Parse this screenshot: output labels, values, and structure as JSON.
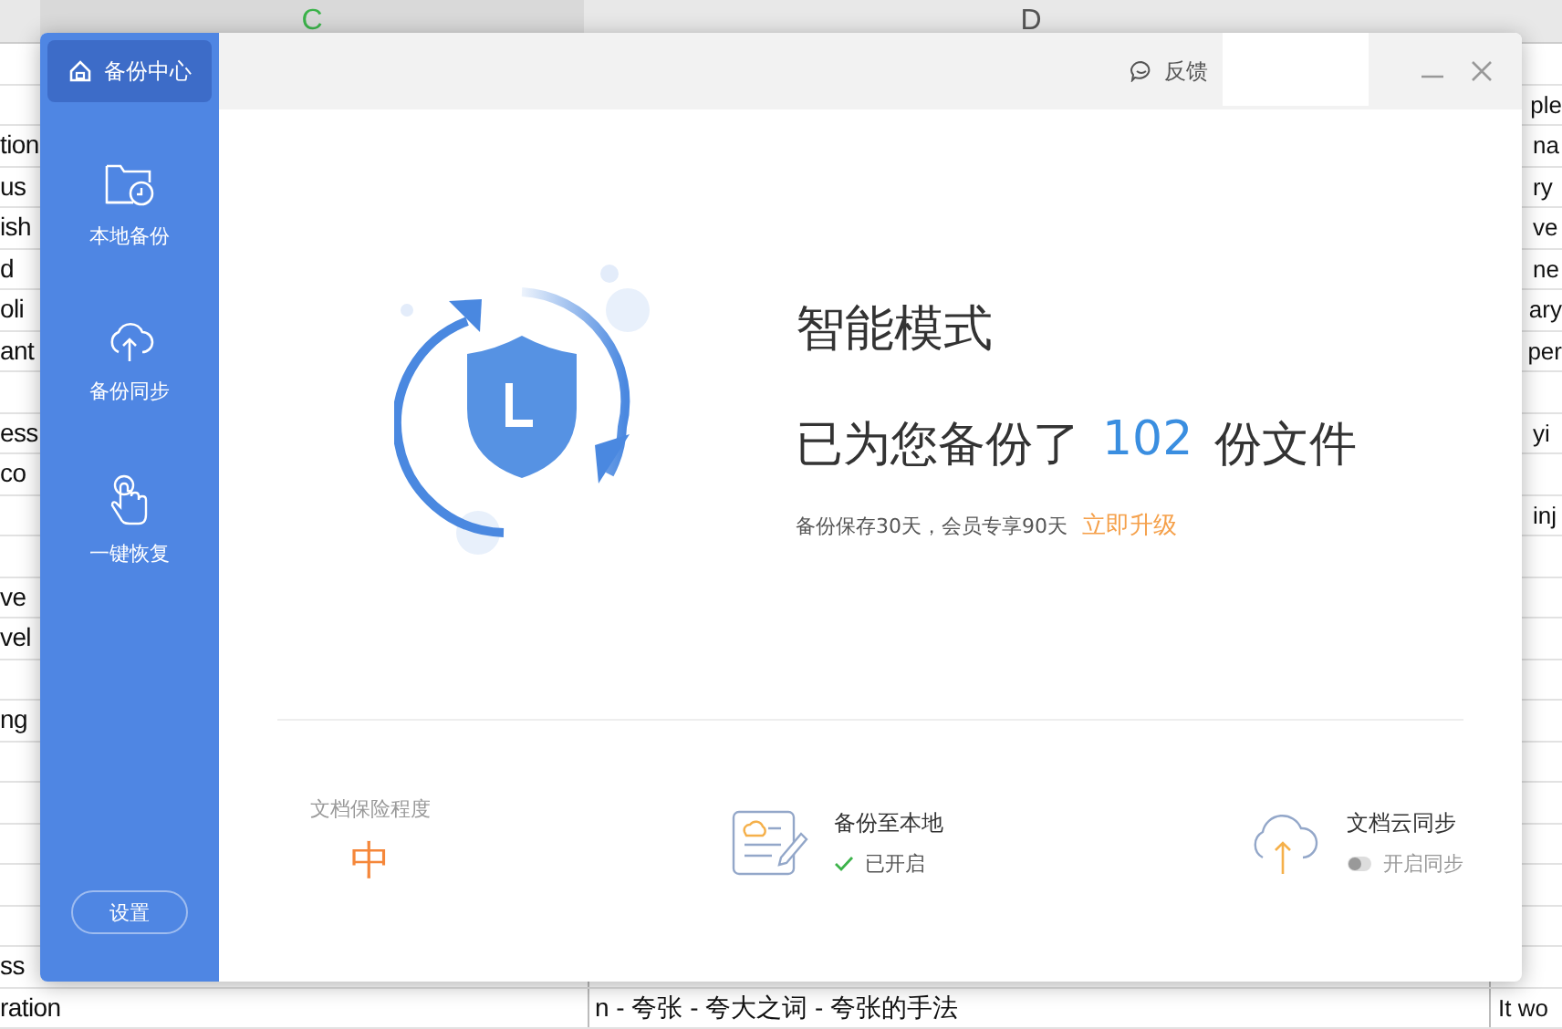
{
  "sheet": {
    "columns": [
      "C",
      "D"
    ],
    "rows": [
      {},
      {
        "right": "ple"
      },
      {
        "left": "tion",
        "right": "na"
      },
      {
        "left": "us",
        "right": "ry"
      },
      {
        "left": "ish",
        "right": "ve"
      },
      {
        "left": "d",
        "right": "ne"
      },
      {
        "left": "oli",
        "right": "ary"
      },
      {
        "left": "ant",
        "right": "per"
      },
      {},
      {
        "left": "ess",
        "right": "yi"
      },
      {
        "left": "co"
      },
      {
        "right": "inj"
      },
      {},
      {
        "left": "ve"
      },
      {
        "left": "vel"
      },
      {},
      {
        "left": "ng"
      },
      {},
      {},
      {},
      {},
      {},
      {
        "left": "ss"
      },
      {
        "left": "ration",
        "middle": "n - 夸张 - 夸大之词 - 夸张的手法",
        "right": "It wo"
      }
    ]
  },
  "dialog": {
    "sidebar": {
      "items": [
        {
          "label": "备份中心",
          "kind": "header",
          "selected": true
        },
        {
          "label": "本地备份",
          "kind": "folder",
          "selected": false
        },
        {
          "label": "备份同步",
          "kind": "cloud",
          "selected": false
        },
        {
          "label": "一键恢复",
          "kind": "hand",
          "selected": false
        }
      ],
      "settings": "设置"
    },
    "titlebar": {
      "feedback": "反馈"
    },
    "mode": "智能模式",
    "summary": {
      "before": "已为您备份了",
      "count": "102",
      "after": "份文件"
    },
    "note": "备份保存30天，会员专享90天",
    "upgrade": "立即升级",
    "footer": [
      {
        "kind": "level",
        "label": "文档保险程度",
        "value": "中"
      },
      {
        "kind": "local",
        "label": "备份至本地",
        "status": "已开启",
        "enabled": true
      },
      {
        "kind": "cloud",
        "label": "文档云同步",
        "status": "开启同步",
        "enabled": false
      }
    ]
  }
}
